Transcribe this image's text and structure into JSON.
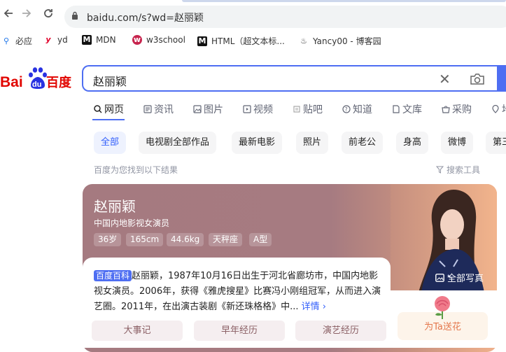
{
  "browser": {
    "url": "baidu.com/s?wd=赵丽颖",
    "bookmarks": [
      {
        "icon": "search-icon",
        "label": "必应"
      },
      {
        "icon": "yd-icon",
        "label": "yd"
      },
      {
        "icon": "mdn-icon",
        "label": "MDN"
      },
      {
        "icon": "w3school-icon",
        "label": "w3school"
      },
      {
        "icon": "mdn-icon",
        "label": "HTML（超文本标..."
      },
      {
        "icon": "cnblogs-icon",
        "label": "Yancy00 - 博客园"
      }
    ]
  },
  "logo": {
    "text_left": "Bai",
    "text_paw": "du",
    "text_right": "百度"
  },
  "search": {
    "query": "赵丽颖"
  },
  "tabs": [
    {
      "label": "网页",
      "icon": "search-icon"
    },
    {
      "label": "资讯",
      "icon": "news-icon"
    },
    {
      "label": "图片",
      "icon": "image-icon"
    },
    {
      "label": "视频",
      "icon": "video-icon"
    },
    {
      "label": "贴吧",
      "icon": "tieba-icon"
    },
    {
      "label": "知道",
      "icon": "question-icon"
    },
    {
      "label": "文库",
      "icon": "doc-icon"
    },
    {
      "label": "采购",
      "icon": "cart-icon"
    },
    {
      "label": "地",
      "icon": "map-icon"
    }
  ],
  "chips": [
    "全部",
    "电视剧全部作品",
    "最新电影",
    "照片",
    "前老公",
    "身高",
    "微博",
    "第三"
  ],
  "results_text": "百度为您找到以下结果",
  "search_tools": "搜索工具",
  "card": {
    "name": "赵丽颖",
    "subtitle": "中国内地影视女演员",
    "tags": [
      "36岁",
      "165cm",
      "44.6kg",
      "天秤座",
      "A型"
    ],
    "all_photos": "全部写真",
    "baike_label": "百度百科",
    "description": "赵丽颖，1987年10月16日出生于河北省廊坊市，中国内地影视女演员。2006年，获得《雅虎搜星》比赛冯小刚组冠军，从而进入演艺圈。2011年，在出演古装剧《新还珠格格》中...",
    "more": "详情",
    "buttons": [
      "大事记",
      "早年经历",
      "演艺经历"
    ],
    "flower": "为Ta送花"
  }
}
